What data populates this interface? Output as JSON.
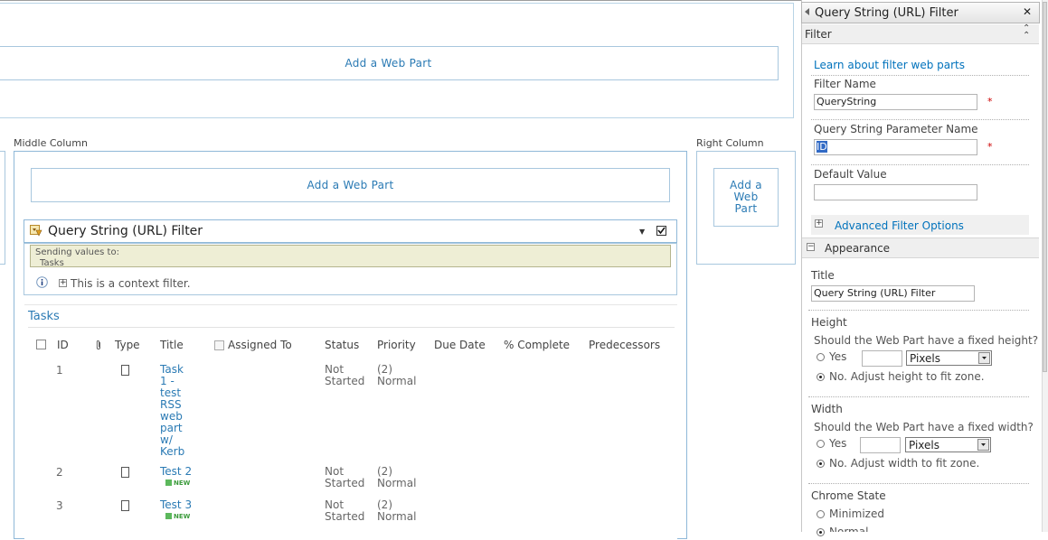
{
  "zones": {
    "top_add_web_part": "Add a Web Part",
    "middle_label": "Middle Column",
    "middle_add_web_part": "Add a Web Part",
    "right_label": "Right Column",
    "right_add_web_part": "Add a Web Part"
  },
  "filter_webpart": {
    "title": "Query String (URL) Filter",
    "sending_values_to": "Sending values to:",
    "target": "Tasks",
    "context_note": "This is a context filter."
  },
  "tasks": {
    "title": "Tasks",
    "columns": [
      "ID",
      "Type",
      "Title",
      "Assigned To",
      "Status",
      "Priority",
      "Due Date",
      "% Complete",
      "Predecessors"
    ],
    "rows": [
      {
        "id": "1",
        "title_lines": [
          "Task",
          "1 -",
          "test",
          "RSS",
          "web",
          "part",
          "w/",
          "Kerb"
        ],
        "status": [
          "Not",
          "Started"
        ],
        "priority": [
          "(2)",
          "Normal"
        ],
        "new": false
      },
      {
        "id": "2",
        "title_lines": [
          "Test 2"
        ],
        "status": [
          "Not",
          "Started"
        ],
        "priority": [
          "(2)",
          "Normal"
        ],
        "new": true
      },
      {
        "id": "3",
        "title_lines": [
          "Test 3"
        ],
        "status": [
          "Not",
          "Started"
        ],
        "priority": [
          "(2)",
          "Normal"
        ],
        "new": true
      }
    ],
    "new_badge": "NEW"
  },
  "toolpane": {
    "title": "Query String (URL) Filter",
    "close_glyph": "✕",
    "filter_section": "Filter",
    "learn_link": "Learn about filter web parts",
    "filter_name_label": "Filter Name",
    "filter_name_value": "QueryString",
    "param_label": "Query String Parameter Name",
    "param_value": "ID",
    "default_label": "Default Value",
    "default_value": "",
    "advanced_link": "Advanced Filter Options",
    "required_mark": "*",
    "appearance_section": "Appearance",
    "title_label": "Title",
    "title_value": "Query String (URL) Filter",
    "height_label": "Height",
    "height_question": "Should the Web Part have a fixed height?",
    "width_label": "Width",
    "width_question": "Should the Web Part have a fixed width?",
    "yes": "Yes",
    "units": "Pixels",
    "no_height": "No. Adjust height to fit zone.",
    "no_width": "No. Adjust width to fit zone.",
    "chrome_label": "Chrome State",
    "minimized": "Minimized",
    "normal": "Normal"
  }
}
